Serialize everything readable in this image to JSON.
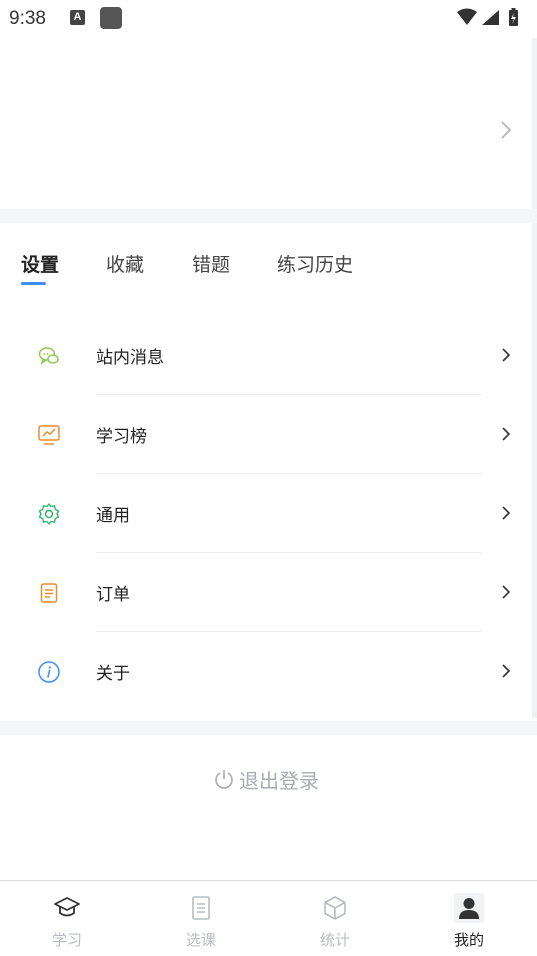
{
  "status_bar": {
    "time": "9:38",
    "notification_letter": "A"
  },
  "tabs": [
    {
      "label": "设置",
      "active": true
    },
    {
      "label": "收藏",
      "active": false
    },
    {
      "label": "错题",
      "active": false
    },
    {
      "label": "练习历史",
      "active": false
    }
  ],
  "menu": [
    {
      "label": "站内消息",
      "icon": "chat-bubbles-icon",
      "color": "#8cc84b"
    },
    {
      "label": "学习榜",
      "icon": "chart-monitor-icon",
      "color": "#f08a2c"
    },
    {
      "label": "通用",
      "icon": "gear-icon",
      "color": "#2fb56b"
    },
    {
      "label": "订单",
      "icon": "document-icon",
      "color": "#f08a2c"
    },
    {
      "label": "关于",
      "icon": "info-icon",
      "color": "#3d8ef5"
    }
  ],
  "logout": {
    "label": "退出登录"
  },
  "tabbar": [
    {
      "label": "学习",
      "icon": "graduation-cap-icon",
      "active": false
    },
    {
      "label": "选课",
      "icon": "list-icon",
      "active": false
    },
    {
      "label": "统计",
      "icon": "cube-icon",
      "active": false
    },
    {
      "label": "我的",
      "icon": "user-icon",
      "active": true
    }
  ],
  "colors": {
    "accent": "#3d8ef5",
    "inactive": "#b9bdc3",
    "section_gap": "#f5f6f8"
  }
}
